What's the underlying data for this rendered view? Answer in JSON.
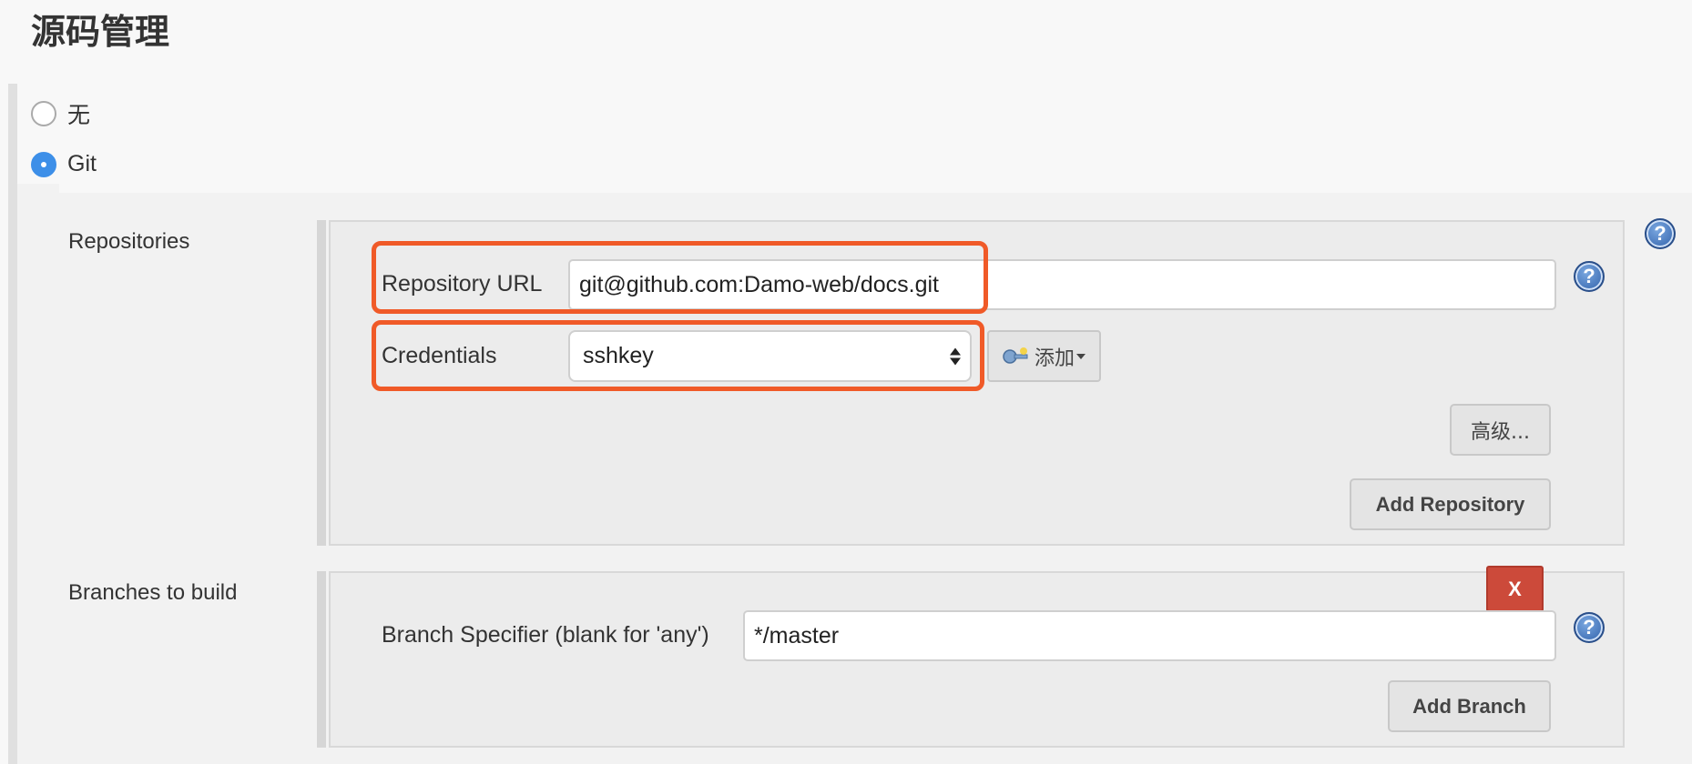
{
  "section": {
    "title": "源码管理"
  },
  "scm_options": [
    {
      "label": "无",
      "selected": false
    },
    {
      "label": "Git",
      "selected": true
    }
  ],
  "repositories": {
    "label": "Repositories",
    "url_label": "Repository URL",
    "url_value": "git@github.com:Damo-web/docs.git",
    "credentials_label": "Credentials",
    "credentials_value": "sshkey",
    "add_credentials_label": "添加",
    "advanced_label": "高级...",
    "add_repository_label": "Add Repository"
  },
  "branches": {
    "label": "Branches to build",
    "specifier_label": "Branch Specifier (blank for 'any')",
    "specifier_value": "*/master",
    "delete_label": "X",
    "add_branch_label": "Add Branch"
  },
  "help": {
    "glyph": "?"
  },
  "colors": {
    "highlight": "#f05a28",
    "radio_selected": "#3d8fe8",
    "delete_button": "#cc4a3a"
  },
  "icons": {
    "help": "help-icon",
    "credential_key": "key-icon",
    "select_arrows": "select-arrows-icon"
  }
}
